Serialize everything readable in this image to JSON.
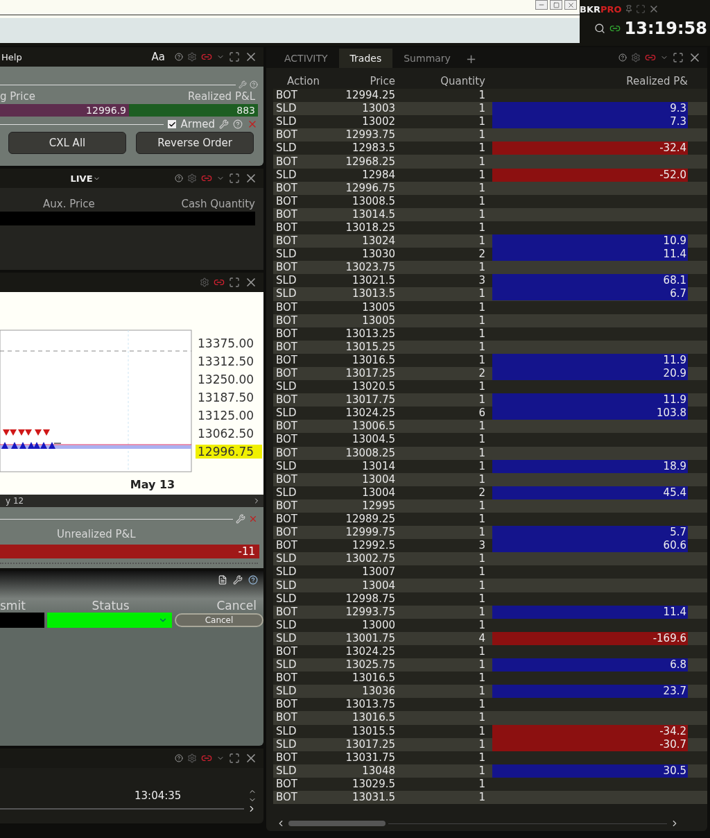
{
  "top_bar": {
    "brand_prefix": "BKR",
    "brand_suffix": "PRO",
    "clock": "13:19:58"
  },
  "order_panel": {
    "menu": "Help",
    "font_button": "Aa",
    "columns": [
      "g Price",
      "Realized P&L"
    ],
    "values": [
      {
        "text": "12996.9",
        "color": "#5e2d4e"
      },
      {
        "text": "883",
        "color": "#1d5e22"
      }
    ],
    "armed": {
      "label": "Armed",
      "checked": true
    },
    "buttons": [
      "CXL All",
      "Reverse Order"
    ]
  },
  "orders_panel": {
    "mode": "LIVE",
    "columns": [
      "Aux. Price",
      "Cash Quantity"
    ]
  },
  "chart_panel": {
    "price_labels": [
      "13375.00",
      "13312.50",
      "13250.00",
      "13187.50",
      "13125.00",
      "13062.50"
    ],
    "last_price": "12996.75",
    "date_label": "May 13",
    "scroll_label": "y 12",
    "pnl_label": "Unrealized P&L",
    "pnl_value": "-11"
  },
  "bottom_panel": {
    "columns": [
      "smit",
      "Status",
      "Cancel"
    ],
    "cancel_button": "Cancel"
  },
  "time_panel": {
    "time": "13:04:35"
  },
  "activity": {
    "tabs": [
      {
        "label": "ACTIVITY",
        "selected": false
      },
      {
        "label": "Trades",
        "selected": true
      },
      {
        "label": "Summary",
        "selected": false
      }
    ],
    "add_tab": "+",
    "columns": [
      "Action",
      "Price",
      "Quantity",
      "Realized P&"
    ],
    "rows": [
      {
        "action": "BOT",
        "price": "12994.25",
        "quantity": "1"
      },
      {
        "action": "SLD",
        "price": "13003",
        "quantity": "1",
        "realized_pnl": "9.3",
        "color": "#14148c"
      },
      {
        "action": "SLD",
        "price": "13002",
        "quantity": "1",
        "realized_pnl": "7.3",
        "color": "#14148c"
      },
      {
        "action": "BOT",
        "price": "12993.75",
        "quantity": "1"
      },
      {
        "action": "SLD",
        "price": "12983.5",
        "quantity": "1",
        "realized_pnl": "-32.4",
        "color": "#8c1010"
      },
      {
        "action": "BOT",
        "price": "12968.25",
        "quantity": "1"
      },
      {
        "action": "SLD",
        "price": "12984",
        "quantity": "1",
        "realized_pnl": "-52.0",
        "color": "#8c1010"
      },
      {
        "action": "BOT",
        "price": "12996.75",
        "quantity": "1"
      },
      {
        "action": "BOT",
        "price": "13008.5",
        "quantity": "1"
      },
      {
        "action": "BOT",
        "price": "13014.5",
        "quantity": "1"
      },
      {
        "action": "BOT",
        "price": "13018.25",
        "quantity": "1"
      },
      {
        "action": "BOT",
        "price": "13024",
        "quantity": "1",
        "realized_pnl": "10.9",
        "color": "#14148c"
      },
      {
        "action": "SLD",
        "price": "13030",
        "quantity": "2",
        "realized_pnl": "11.4",
        "color": "#14148c"
      },
      {
        "action": "BOT",
        "price": "13023.75",
        "quantity": "1"
      },
      {
        "action": "SLD",
        "price": "13021.5",
        "quantity": "3",
        "realized_pnl": "68.1",
        "color": "#14148c"
      },
      {
        "action": "SLD",
        "price": "13013.5",
        "quantity": "1",
        "realized_pnl": "6.7",
        "color": "#14148c"
      },
      {
        "action": "BOT",
        "price": "13005",
        "quantity": "1"
      },
      {
        "action": "BOT",
        "price": "13005",
        "quantity": "1"
      },
      {
        "action": "BOT",
        "price": "13013.25",
        "quantity": "1"
      },
      {
        "action": "BOT",
        "price": "13015.25",
        "quantity": "1"
      },
      {
        "action": "BOT",
        "price": "13016.5",
        "quantity": "1",
        "realized_pnl": "11.9",
        "color": "#14148c"
      },
      {
        "action": "BOT",
        "price": "13017.25",
        "quantity": "2",
        "realized_pnl": "20.9",
        "color": "#14148c"
      },
      {
        "action": "SLD",
        "price": "13020.5",
        "quantity": "1"
      },
      {
        "action": "BOT",
        "price": "13017.75",
        "quantity": "1",
        "realized_pnl": "11.9",
        "color": "#14148c"
      },
      {
        "action": "SLD",
        "price": "13024.25",
        "quantity": "6",
        "realized_pnl": "103.8",
        "color": "#14148c"
      },
      {
        "action": "BOT",
        "price": "13006.5",
        "quantity": "1"
      },
      {
        "action": "BOT",
        "price": "13004.5",
        "quantity": "1"
      },
      {
        "action": "BOT",
        "price": "13008.25",
        "quantity": "1"
      },
      {
        "action": "SLD",
        "price": "13014",
        "quantity": "1",
        "realized_pnl": "18.9",
        "color": "#14148c"
      },
      {
        "action": "BOT",
        "price": "13004",
        "quantity": "1"
      },
      {
        "action": "SLD",
        "price": "13004",
        "quantity": "2",
        "realized_pnl": "45.4",
        "color": "#14148c"
      },
      {
        "action": "BOT",
        "price": "12995",
        "quantity": "1"
      },
      {
        "action": "BOT",
        "price": "12989.25",
        "quantity": "1"
      },
      {
        "action": "BOT",
        "price": "12999.75",
        "quantity": "1",
        "realized_pnl": "5.7",
        "color": "#14148c"
      },
      {
        "action": "BOT",
        "price": "12992.5",
        "quantity": "3",
        "realized_pnl": "60.6",
        "color": "#14148c"
      },
      {
        "action": "SLD",
        "price": "13002.75",
        "quantity": "1"
      },
      {
        "action": "SLD",
        "price": "13007",
        "quantity": "1"
      },
      {
        "action": "SLD",
        "price": "13004",
        "quantity": "1"
      },
      {
        "action": "SLD",
        "price": "12998.75",
        "quantity": "1"
      },
      {
        "action": "BOT",
        "price": "12993.75",
        "quantity": "1",
        "realized_pnl": "11.4",
        "color": "#14148c"
      },
      {
        "action": "SLD",
        "price": "13000",
        "quantity": "1"
      },
      {
        "action": "SLD",
        "price": "13001.75",
        "quantity": "4",
        "realized_pnl": "-169.6",
        "color": "#8c1010"
      },
      {
        "action": "BOT",
        "price": "13024.25",
        "quantity": "1"
      },
      {
        "action": "SLD",
        "price": "13025.75",
        "quantity": "1",
        "realized_pnl": "6.8",
        "color": "#14148c"
      },
      {
        "action": "BOT",
        "price": "13016.5",
        "quantity": "1"
      },
      {
        "action": "SLD",
        "price": "13036",
        "quantity": "1",
        "realized_pnl": "23.7",
        "color": "#14148c"
      },
      {
        "action": "BOT",
        "price": "13013.75",
        "quantity": "1"
      },
      {
        "action": "BOT",
        "price": "13016.5",
        "quantity": "1"
      },
      {
        "action": "SLD",
        "price": "13015.5",
        "quantity": "1",
        "realized_pnl": "-34.2",
        "color": "#8c1010"
      },
      {
        "action": "SLD",
        "price": "13017.25",
        "quantity": "1",
        "realized_pnl": "-30.7",
        "color": "#8c1010"
      },
      {
        "action": "BOT",
        "price": "13031.75",
        "quantity": "1"
      },
      {
        "action": "SLD",
        "price": "13048",
        "quantity": "1",
        "realized_pnl": "30.5",
        "color": "#14148c"
      },
      {
        "action": "BOT",
        "price": "13029.5",
        "quantity": "1"
      },
      {
        "action": "BOT",
        "price": "13031.5",
        "quantity": "1"
      }
    ]
  }
}
